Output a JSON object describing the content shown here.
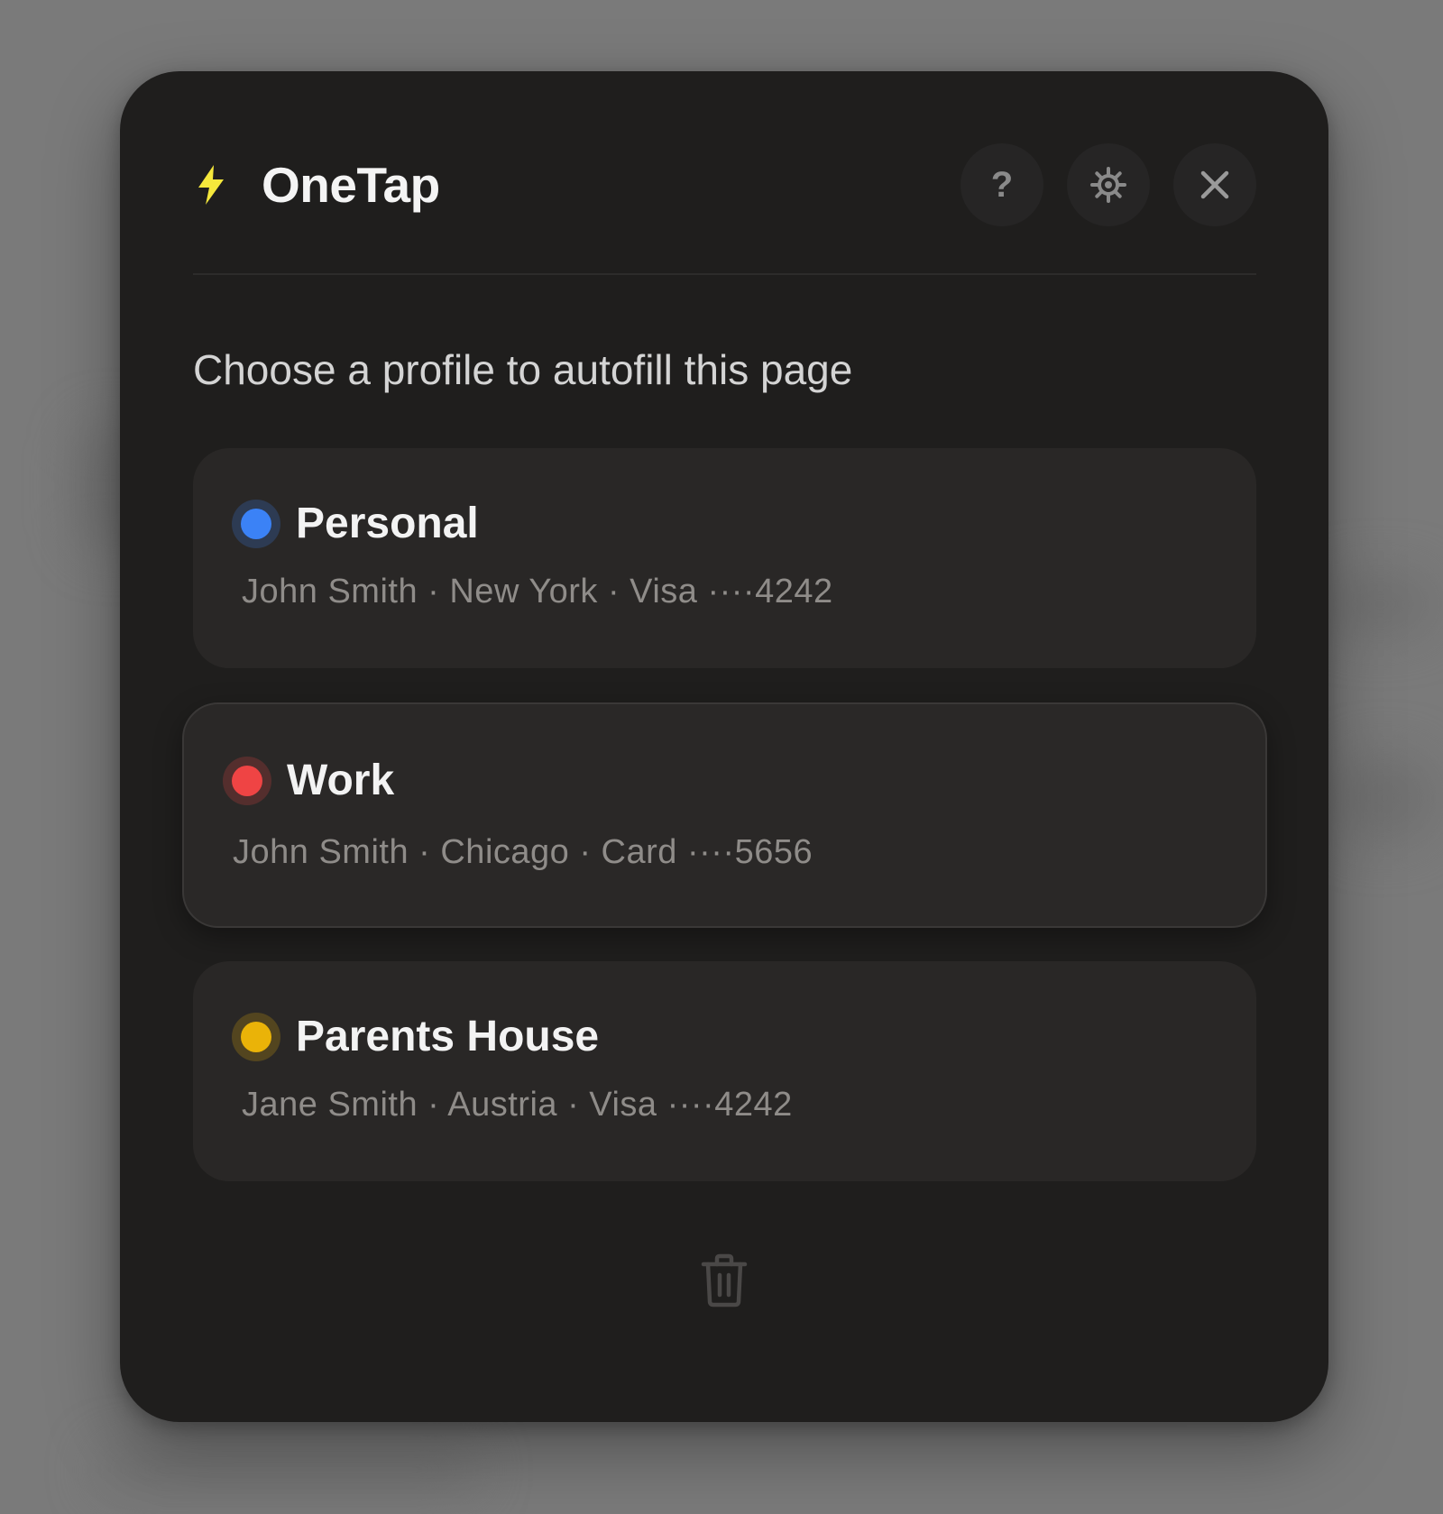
{
  "app": {
    "title": "OneTap",
    "accent_color": "#f5e83c"
  },
  "header": {
    "help_label": "?",
    "buttons": [
      "help-icon",
      "gear-icon",
      "close-icon"
    ]
  },
  "prompt": "Choose a profile to autofill this page",
  "profiles": [
    {
      "name": "Personal",
      "detail": "John Smith · New York · Visa ····4242",
      "color": "#3b82f6",
      "selected": false
    },
    {
      "name": "Work",
      "detail": "John Smith · Chicago · Card ····5656",
      "color": "#ef4444",
      "selected": true
    },
    {
      "name": "Parents House",
      "detail": "Jane Smith · Austria · Visa ····4242",
      "color": "#eab308",
      "selected": false
    }
  ],
  "footer": {
    "icon": "trash-icon"
  }
}
